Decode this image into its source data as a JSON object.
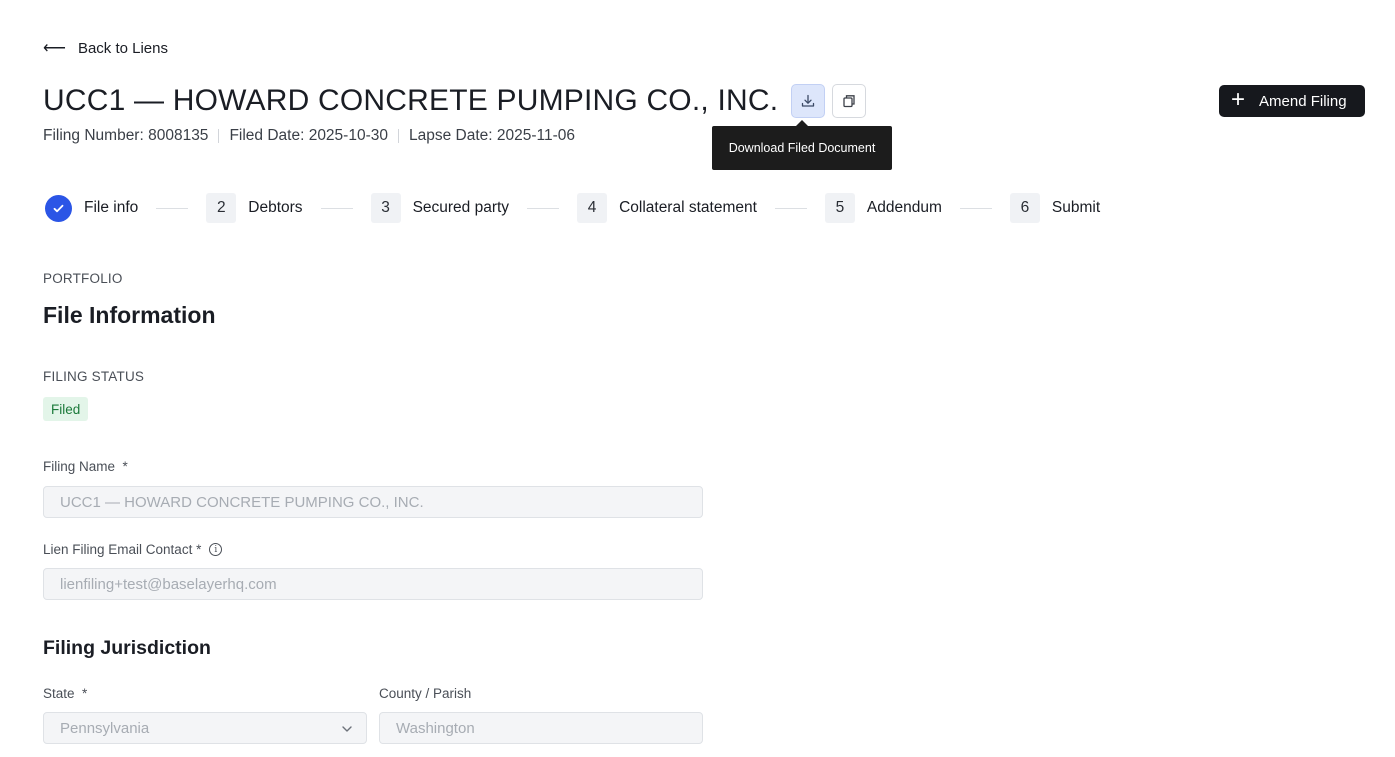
{
  "nav": {
    "back_label": "Back to Liens"
  },
  "header": {
    "title": "UCC1 — HOWARD CONCRETE PUMPING CO., INC.",
    "download_tooltip": "Download Filed Document",
    "amend_label": "Amend Filing",
    "filing_number": "Filing Number: 8008135",
    "filed_date": "Filed Date: 2025-10-30",
    "lapse_date": "Lapse Date: 2025-11-06"
  },
  "steps": [
    {
      "label": "File info",
      "status": "complete"
    },
    {
      "num": "2",
      "label": "Debtors"
    },
    {
      "num": "3",
      "label": "Secured party"
    },
    {
      "num": "4",
      "label": "Collateral statement"
    },
    {
      "num": "5",
      "label": "Addendum"
    },
    {
      "num": "6",
      "label": "Submit"
    }
  ],
  "section": {
    "kicker": "PORTFOLIO",
    "title": "File Information",
    "status_label": "FILING STATUS",
    "status_value": "Filed"
  },
  "fields": {
    "filing_name_label": "Filing Name  *",
    "filing_name_value": "UCC1 — HOWARD CONCRETE PUMPING CO., INC.",
    "email_label": "Lien Filing Email Contact *",
    "email_value": "lienfiling+test@baselayerhq.com"
  },
  "jurisdiction": {
    "title": "Filing Jurisdiction",
    "state_label": "State  *",
    "state_value": "Pennsylvania",
    "county_label": "County / Parish",
    "county_value": "Washington"
  },
  "colors": {
    "accent": "#2b55e6",
    "primary_button": "#16181d",
    "status_bg": "#e3f5e9",
    "status_text": "#1b7a3a"
  }
}
